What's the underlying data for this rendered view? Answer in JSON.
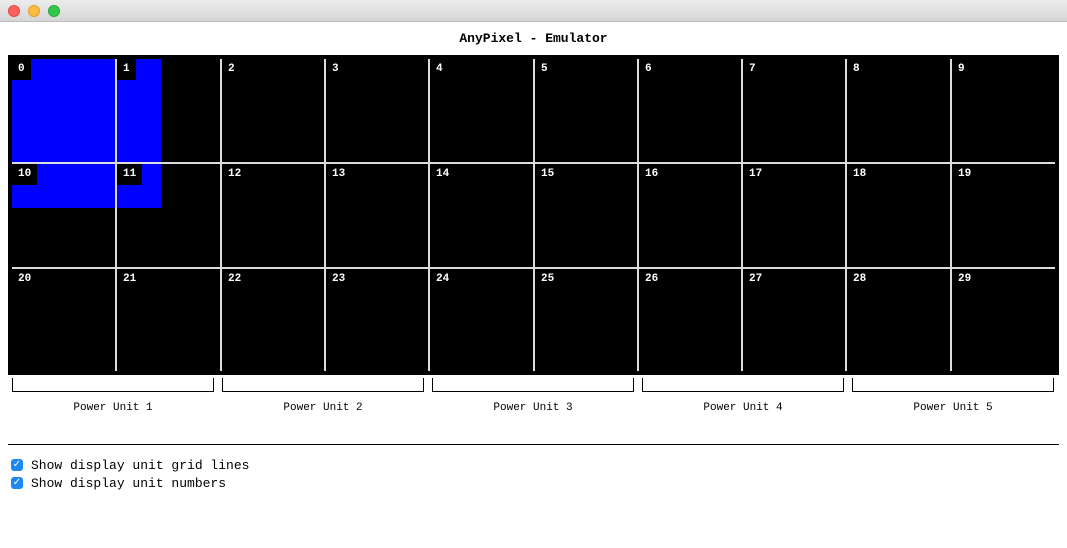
{
  "window": {
    "title": "AnyPixel - Emulator"
  },
  "display": {
    "rows": 3,
    "cols": 10,
    "unit_numbers": [
      "0",
      "1",
      "2",
      "3",
      "4",
      "5",
      "6",
      "7",
      "8",
      "9",
      "10",
      "11",
      "12",
      "13",
      "14",
      "15",
      "16",
      "17",
      "18",
      "19",
      "20",
      "21",
      "22",
      "23",
      "24",
      "25",
      "26",
      "27",
      "28",
      "29"
    ],
    "lit_color": "#0000ff",
    "background_color": "#000000",
    "grid_line_color": "#dcdcdc"
  },
  "power_units": [
    "Power Unit 1",
    "Power Unit 2",
    "Power Unit 3",
    "Power Unit 4",
    "Power Unit 5"
  ],
  "options": [
    {
      "label": "Show display unit grid lines",
      "checked": true
    },
    {
      "label": "Show display unit numbers",
      "checked": true
    }
  ],
  "checkbox_color": "#1e88f5"
}
